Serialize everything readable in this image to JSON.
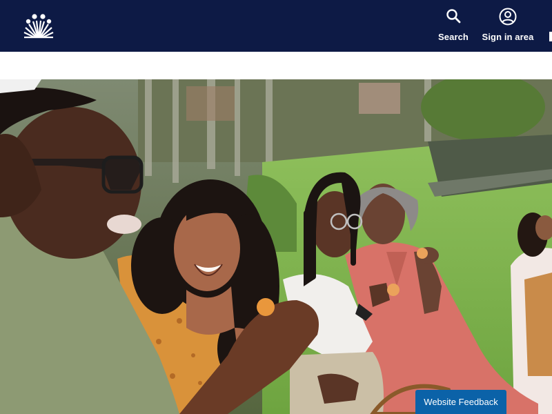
{
  "header": {
    "logo_icon": "kaiser-permanente-logo",
    "background_color": "#0d1a45",
    "nav": [
      {
        "label": "Search",
        "icon": "search-icon"
      },
      {
        "label": "Sign in area",
        "icon": "user-circle-icon"
      }
    ]
  },
  "hero": {
    "image": "friends-laughing-at-picnic-photo"
  },
  "feedback": {
    "label": "Website Feedback",
    "color": "#0b62a8"
  }
}
